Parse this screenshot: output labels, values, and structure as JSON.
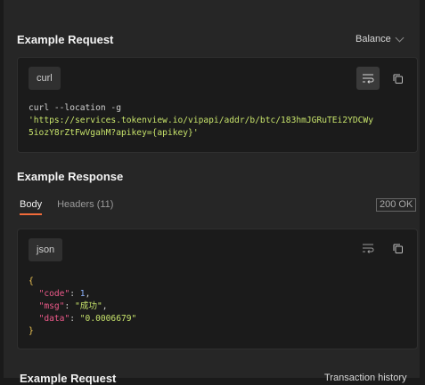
{
  "request": {
    "title": "Example Request",
    "dropdown": "Balance",
    "language": "curl",
    "code_cmd": "curl --location -g",
    "code_url_1": "'https://services.tokenview.io/vipapi/addr/b/btc/183hmJGRuTEi2YDCWy",
    "code_url_2": "5iozY8rZtFwVgahM?apikey={apikey}'"
  },
  "response": {
    "title": "Example Response",
    "tabs": [
      {
        "label": "Body"
      },
      {
        "label": "Headers (11)"
      }
    ],
    "status": "200 OK",
    "language": "json",
    "lines": {
      "open": "{",
      "code_key": "\"code\"",
      "code_val": "1",
      "msg_key": "\"msg\"",
      "msg_val": "\"成功\"",
      "data_key": "\"data\"",
      "data_val": "\"0.0006679\"",
      "close": "}"
    }
  },
  "next_section": {
    "title": "Example Request",
    "dropdown": "Transaction history"
  },
  "colors": {
    "accent": "#f26b3a",
    "string": "#c7e36b",
    "key": "#ef5a8b",
    "number": "#8fb3ff"
  }
}
